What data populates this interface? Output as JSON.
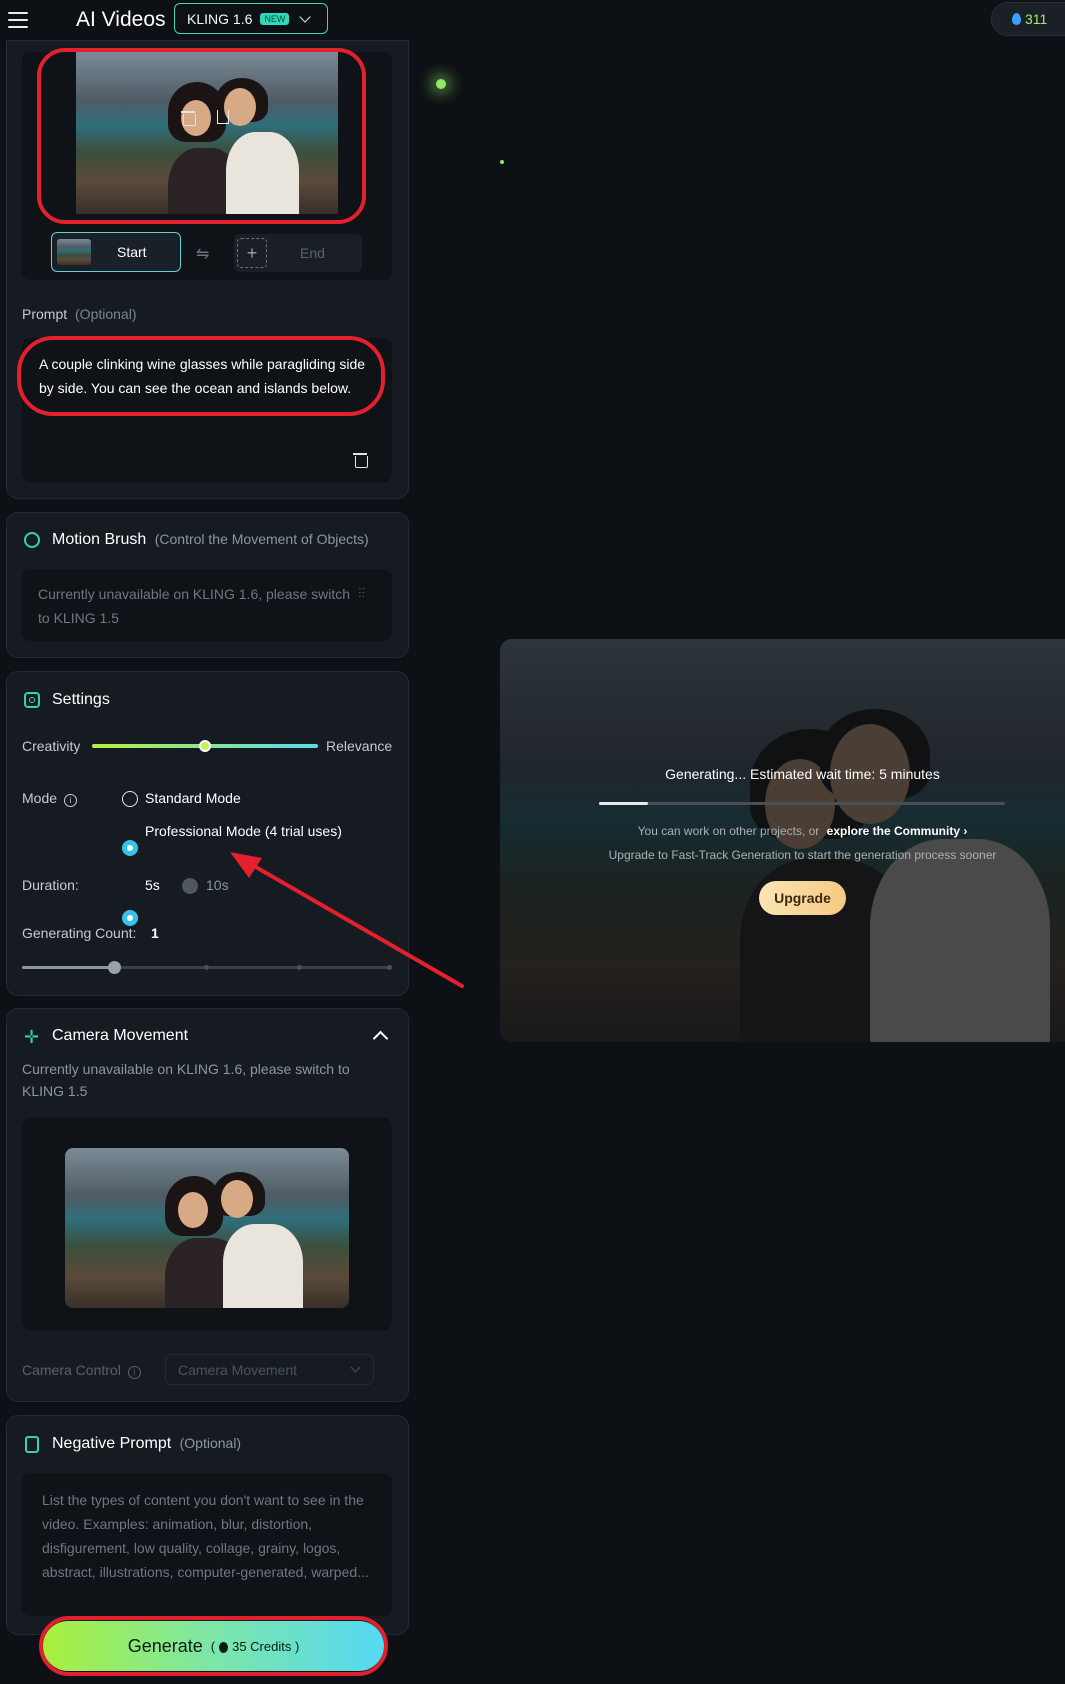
{
  "header": {
    "title": "AI Videos",
    "model": "KLING 1.6",
    "model_badge": "NEW",
    "credits": "311"
  },
  "frames": {
    "start_label": "Start",
    "end_label": "End"
  },
  "prompt": {
    "label": "Prompt",
    "optional": "(Optional)",
    "text": "A couple clinking wine glasses while paragliding side by side. You can see the ocean and islands below."
  },
  "motion_brush": {
    "title": "Motion Brush",
    "subtitle": "(Control the Movement of Objects)",
    "notice": "Currently unavailable on KLING 1.6, please switch to KLING 1.5"
  },
  "settings": {
    "title": "Settings",
    "creativity": "Creativity",
    "relevance": "Relevance",
    "creativity_value": 0.5,
    "mode_label": "Mode",
    "mode_standard": "Standard Mode",
    "mode_pro": "Professional Mode (4 trial uses)",
    "duration_label": "Duration:",
    "duration_5": "5s",
    "duration_10": "10s",
    "count_label": "Generating Count:",
    "count_value": "1"
  },
  "camera": {
    "title": "Camera Movement",
    "notice": "Currently unavailable on KLING 1.6, please switch to KLING 1.5",
    "control_label": "Camera Control",
    "control_placeholder": "Camera Movement"
  },
  "negative": {
    "title": "Negative Prompt",
    "optional": "(Optional)",
    "placeholder": "List the types of content you don't want to see in the video. Examples: animation, blur, distortion, disfigurement, low quality, collage, grainy, logos, abstract, illustrations, computer-generated, warped..."
  },
  "generate": {
    "label": "Generate",
    "credits": "35 Credits"
  },
  "status": {
    "generating": "Generating... Estimated wait time: 5 minutes",
    "progress": 0.12,
    "work_text": "You can work on other projects, or",
    "community_link": "explore the Community",
    "fast_track": "Upgrade to Fast-Track Generation to start the generation process sooner",
    "upgrade_label": "Upgrade"
  },
  "colors": {
    "accent": "#35d2b0",
    "annotation": "#e3202d"
  }
}
